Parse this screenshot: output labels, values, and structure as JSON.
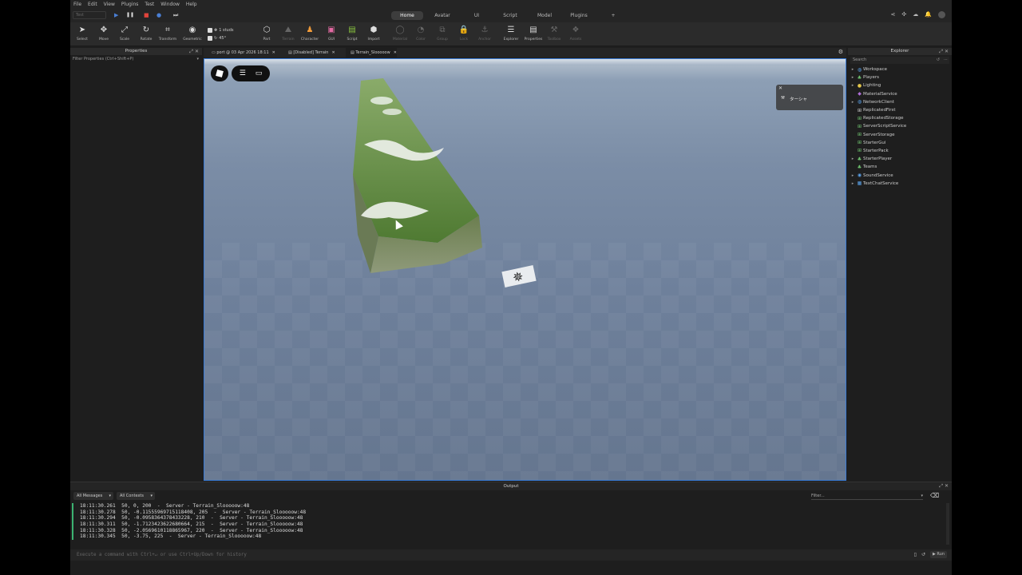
{
  "menu": [
    "File",
    "Edit",
    "View",
    "Plugins",
    "Test",
    "Window",
    "Help"
  ],
  "test_selector": "Test",
  "play_icons": {
    "play": "▶",
    "pause": "❚❚",
    "stop": "■",
    "record": "●",
    "step": "⏭"
  },
  "ribbon_tabs": [
    "Home",
    "Avatar",
    "UI",
    "Script",
    "Model",
    "Plugins",
    "+"
  ],
  "active_tab": "Home",
  "toolbar": {
    "tools": [
      {
        "label": "Select",
        "icon": "➤"
      },
      {
        "label": "Move",
        "icon": "✥"
      },
      {
        "label": "Scale",
        "icon": "⤢"
      },
      {
        "label": "Rotate",
        "icon": "↻"
      },
      {
        "label": "Transform",
        "icon": "⌗"
      },
      {
        "label": "Geometric",
        "icon": "◉"
      }
    ],
    "snap": {
      "move": "1 studs",
      "rotate": "45°"
    },
    "insert_tools": [
      {
        "label": "Part",
        "icon": "⬡",
        "dim": false
      },
      {
        "label": "Terrain",
        "icon": "⛰",
        "dim": true
      },
      {
        "label": "Character",
        "icon": "♟",
        "dim": false
      },
      {
        "label": "GUI",
        "icon": "▣",
        "dim": false
      },
      {
        "label": "Script",
        "icon": "▤",
        "dim": false
      },
      {
        "label": "Import",
        "icon": "⬢",
        "dim": false
      }
    ],
    "edit_tools": [
      {
        "label": "Material",
        "icon": "◯",
        "dim": true
      },
      {
        "label": "Color",
        "icon": "◔",
        "dim": true
      },
      {
        "label": "Group",
        "icon": "⧉",
        "dim": true
      },
      {
        "label": "Lock",
        "icon": "🔒",
        "dim": true
      },
      {
        "label": "Anchor",
        "icon": "⚓",
        "dim": true
      }
    ],
    "window_tools": [
      {
        "label": "Explorer",
        "icon": "☰",
        "dim": false
      },
      {
        "label": "Properties",
        "icon": "▤",
        "dim": false
      },
      {
        "label": "Toolbox",
        "icon": "⚒",
        "dim": true
      },
      {
        "label": "Assets",
        "icon": "❖",
        "dim": true
      }
    ]
  },
  "properties": {
    "title": "Properties",
    "filter": "Filter Properties (Ctrl+Shift+P)"
  },
  "doc_tabs": [
    "port @ 03 Apr 2026 18:11",
    "[Disabled] Terrain",
    "Terrain_Slooooow"
  ],
  "viewport": {
    "popup_label": "ターシャ",
    "accent_color": "#3a7bd5"
  },
  "explorer": {
    "title": "Explorer",
    "search_placeholder": "Search",
    "items": [
      {
        "label": "Workspace",
        "icon": "◍",
        "color": "#5aa0e6",
        "arrow": "▸"
      },
      {
        "label": "Players",
        "icon": "♣",
        "color": "#6fc36f",
        "arrow": "▸"
      },
      {
        "label": "Lighting",
        "icon": "●",
        "color": "#e6c84b",
        "arrow": "▸"
      },
      {
        "label": "MaterialService",
        "icon": "◆",
        "color": "#b06fd8",
        "arrow": ""
      },
      {
        "label": "NetworkClient",
        "icon": "◍",
        "color": "#5aa0e6",
        "arrow": "▸"
      },
      {
        "label": "ReplicatedFirst",
        "icon": "⊞",
        "color": "#ccc",
        "arrow": ""
      },
      {
        "label": "ReplicatedStorage",
        "icon": "⊞",
        "color": "#6fc36f",
        "arrow": ""
      },
      {
        "label": "ServerScriptService",
        "icon": "⊞",
        "color": "#6fc36f",
        "arrow": ""
      },
      {
        "label": "ServerStorage",
        "icon": "⊞",
        "color": "#6fc36f",
        "arrow": ""
      },
      {
        "label": "StarterGui",
        "icon": "⊞",
        "color": "#6fc36f",
        "arrow": ""
      },
      {
        "label": "StarterPack",
        "icon": "⊞",
        "color": "#6fc36f",
        "arrow": ""
      },
      {
        "label": "StarterPlayer",
        "icon": "♣",
        "color": "#6fc36f",
        "arrow": "▸"
      },
      {
        "label": "Teams",
        "icon": "♣",
        "color": "#6fc36f",
        "arrow": ""
      },
      {
        "label": "SoundService",
        "icon": "◉",
        "color": "#5aa0e6",
        "arrow": "▸"
      },
      {
        "label": "TextChatService",
        "icon": "▦",
        "color": "#5aa0e6",
        "arrow": "▸"
      }
    ]
  },
  "output": {
    "title": "Output",
    "filter_messages": "All Messages",
    "filter_contexts": "All Contexts",
    "filter_placeholder": "Filter...",
    "lines": [
      "18:11:30.261  50, 0, 200  -  Server - Terrain_Slooooow:48",
      "18:11:30.278  50, -0.11555969715118408, 205  -  Server - Terrain_Slooooow:48",
      "18:11:30.294  50, -0.0958364378433228, 210  -  Server - Terrain_Slooooow:48",
      "18:11:30.311  50, -1.7123423622680664, 215  -  Server - Terrain_Slooooow:48",
      "18:11:30.328  50, -2.0569610118865967, 220  -  Server - Terrain_Slooooow:48",
      "18:11:30.345  50, -3.75, 225  -  Server - Terrain_Slooooow:48"
    ],
    "command_placeholder": "Execute a command with Ctrl+↵ or use Ctrl+Up/Down for history",
    "run_label": "▶ Run"
  }
}
